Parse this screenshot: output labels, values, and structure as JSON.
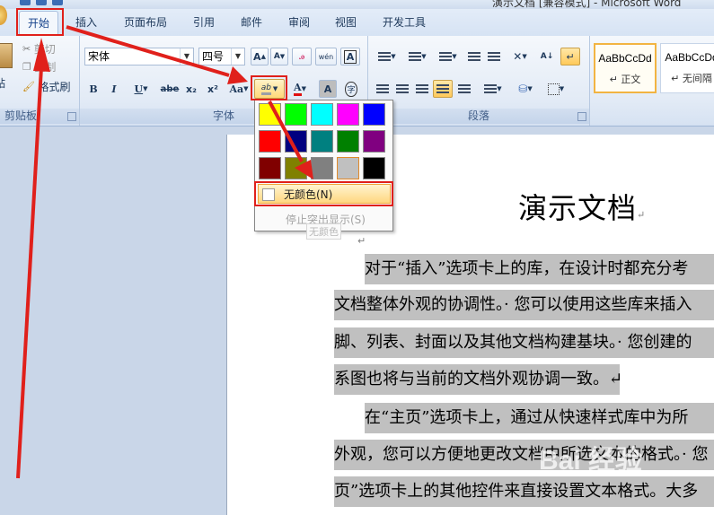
{
  "window": {
    "title": "演示文档 [兼容模式] - Microsoft Word"
  },
  "tabs": [
    {
      "label": "开始",
      "active": true
    },
    {
      "label": "插入"
    },
    {
      "label": "页面布局"
    },
    {
      "label": "引用"
    },
    {
      "label": "邮件"
    },
    {
      "label": "审阅"
    },
    {
      "label": "视图"
    },
    {
      "label": "开发工具"
    }
  ],
  "clipboard": {
    "label": "剪贴板",
    "paste": "贴",
    "cut": "剪切",
    "copy": "复制",
    "format_painter": "格式刷"
  },
  "font": {
    "label": "字体",
    "name": "宋体",
    "size": "四号",
    "highlight_icon": "ab",
    "buttons": {
      "bold": "B",
      "italic": "I",
      "underline": "U",
      "strike": "abe",
      "subscript": "x₂",
      "superscript": "x²",
      "change_case": "Aa",
      "grow": "A",
      "shrink": "A",
      "clear": "A",
      "phonetic": "wén",
      "border": "A",
      "color": "A",
      "shading": "A",
      "encircle": "字"
    }
  },
  "paragraph": {
    "label": "段落"
  },
  "styles": [
    {
      "preview": "AaBbCcDd",
      "name": "↵ 正文",
      "selected": true
    },
    {
      "preview": "AaBbCcDd",
      "name": "↵ 无间隔"
    }
  ],
  "highlight_menu": {
    "colors": [
      "#ffff00",
      "#00ff00",
      "#00ffff",
      "#ff00ff",
      "#0000ff",
      "#ff0000",
      "#000080",
      "#008080",
      "#008000",
      "#800080",
      "#800000",
      "#808000",
      "#808080",
      "#c0c0c0",
      "#000000"
    ],
    "no_color": "无颜色(N)",
    "stop": "停止突出显示(S)",
    "tooltip": "无颜色"
  },
  "document": {
    "title": "演示文档",
    "title_mark": "↵",
    "empty_mark": "↵",
    "lines": [
      "对于“插入”选项卡上的库，在设计时都充分考",
      "文档整体外观的协调性。· 您可以使用这些库来插入",
      "脚、列表、封面以及其他文档构建基块。· 您创建的",
      "系图也将与当前的文档外观协调一致。↵",
      "在“主页”选项卡上，通过从快速样式库中为所",
      "外观，您可以方便地更改文档中所选文本的格式。· 您",
      "页”选项卡上的其他控件来直接设置文本格式。大多"
    ]
  },
  "watermark": "Bai 经验",
  "annotation_color": "#e0201b"
}
